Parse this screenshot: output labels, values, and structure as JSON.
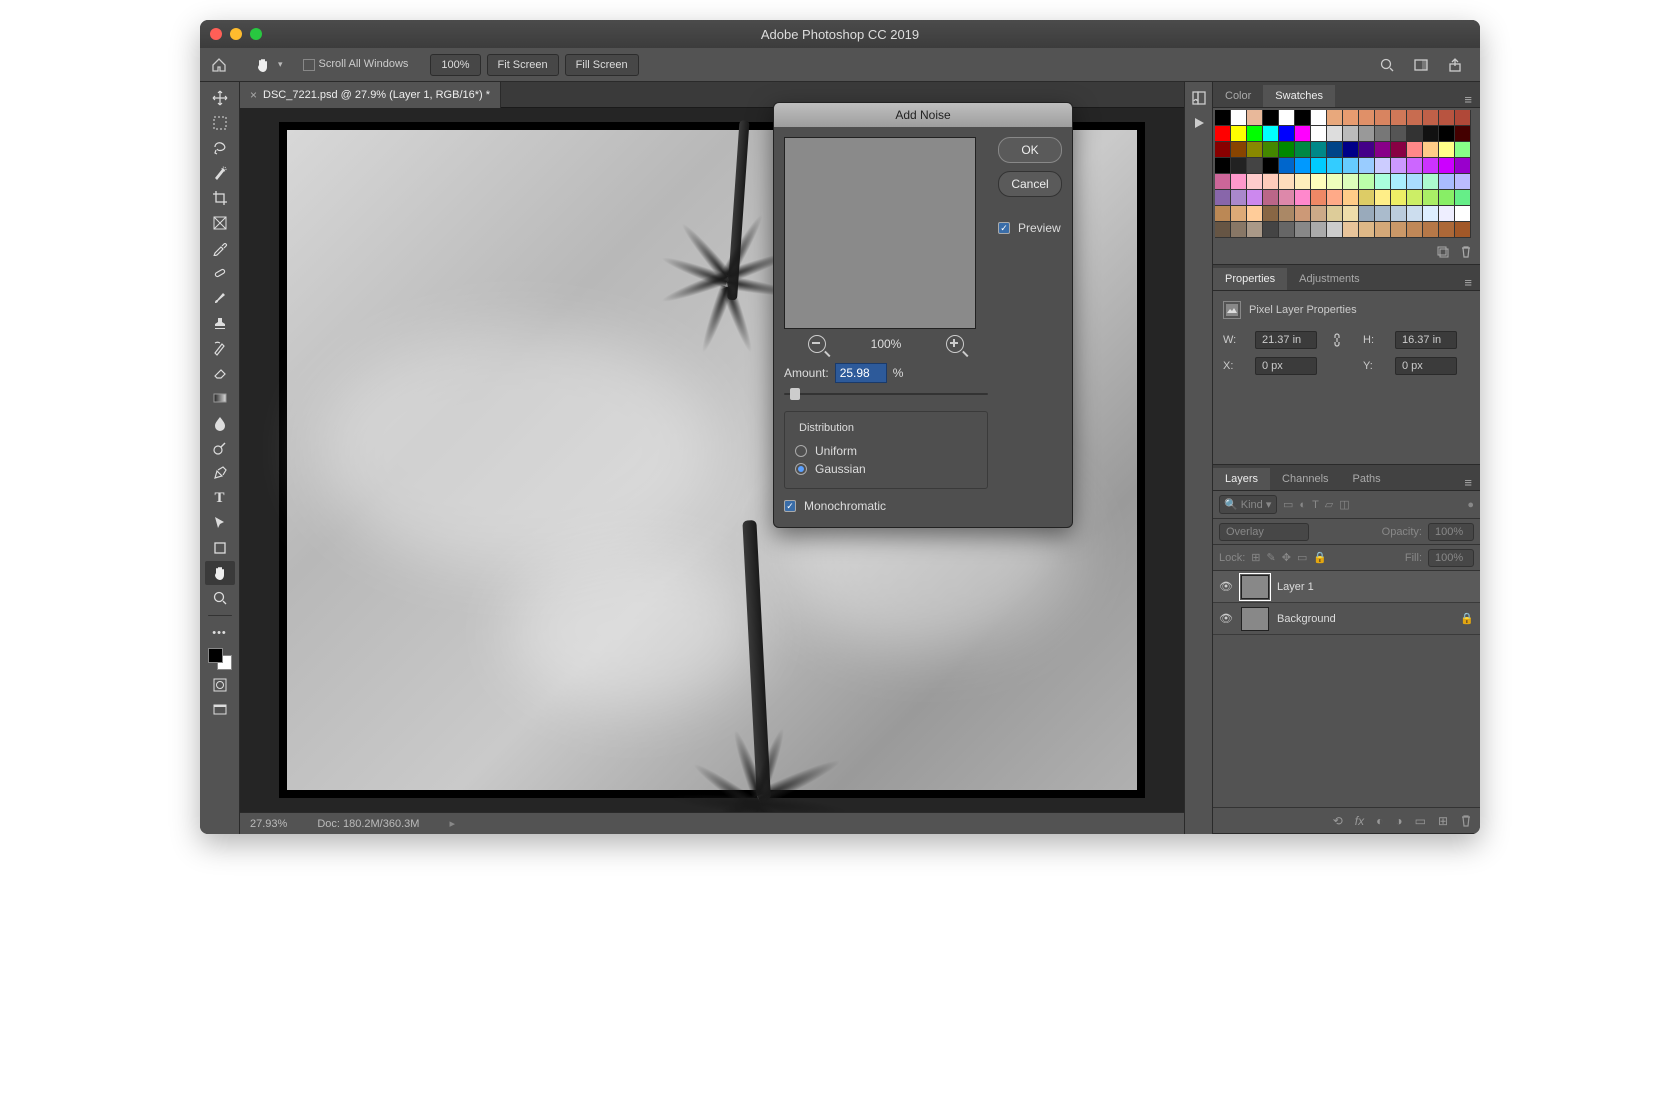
{
  "app": {
    "title": "Adobe Photoshop CC 2019"
  },
  "options_bar": {
    "scroll_all_label": "Scroll All Windows",
    "zoom_value": "100%",
    "fit_screen": "Fit Screen",
    "fill_screen": "Fill Screen"
  },
  "document": {
    "tab_label": "DSC_7221.psd @ 27.9% (Layer 1, RGB/16*) *",
    "status_zoom": "27.93%",
    "status_doc": "Doc: 180.2M/360.3M"
  },
  "dialog": {
    "title": "Add Noise",
    "ok": "OK",
    "cancel": "Cancel",
    "preview_label": "Preview",
    "preview_checked": true,
    "preview_zoom": "100%",
    "amount_label": "Amount:",
    "amount_value": "25.98",
    "amount_unit": "%",
    "distribution_label": "Distribution",
    "uniform": "Uniform",
    "gaussian": "Gaussian",
    "distribution_selected": "gaussian",
    "monochromatic": "Monochromatic",
    "monochromatic_checked": true
  },
  "panels": {
    "color_tab": "Color",
    "swatches_tab": "Swatches",
    "properties_tab": "Properties",
    "adjustments_tab": "Adjustments",
    "layers_tab": "Layers",
    "channels_tab": "Channels",
    "paths_tab": "Paths"
  },
  "properties": {
    "header": "Pixel Layer Properties",
    "w_label": "W:",
    "w_value": "21.37 in",
    "h_label": "H:",
    "h_value": "16.37 in",
    "x_label": "X:",
    "x_value": "0 px",
    "y_label": "Y:",
    "y_value": "0 px"
  },
  "layers": {
    "kind_placeholder": "Kind",
    "blend_mode": "Overlay",
    "opacity_label": "Opacity:",
    "opacity_value": "100%",
    "lock_label": "Lock:",
    "fill_label": "Fill:",
    "fill_value": "100%",
    "items": [
      {
        "name": "Layer 1",
        "selected": true,
        "locked": false
      },
      {
        "name": "Background",
        "selected": false,
        "locked": true
      }
    ]
  },
  "swatch_rows": [
    [
      "#000",
      "#fff",
      "#e8b89a",
      "#000",
      "#fff",
      "#000",
      "#fff",
      "#e8a87c",
      "#e89c70",
      "#e09068",
      "#d88460",
      "#d07858",
      "#c86c50",
      "#c06048",
      "#b85440",
      "#b04838"
    ],
    [
      "#f00",
      "#ff0",
      "#0f0",
      "#0ff",
      "#00f",
      "#f0f",
      "#fff",
      "#ddd",
      "#bbb",
      "#999",
      "#777",
      "#555",
      "#333",
      "#111",
      "#000",
      "#400"
    ],
    [
      "#800",
      "#840",
      "#880",
      "#480",
      "#080",
      "#084",
      "#088",
      "#048",
      "#008",
      "#408",
      "#808",
      "#804",
      "#f88",
      "#fc8",
      "#ff8",
      "#8f8"
    ],
    [
      "#000",
      "#222",
      "#444",
      "#000",
      "#06c",
      "#09f",
      "#0cf",
      "#3cf",
      "#6cf",
      "#9cf",
      "#ccf",
      "#c9f",
      "#c6f",
      "#c3f",
      "#c0f",
      "#90c"
    ],
    [
      "#c69",
      "#f9c",
      "#fcc",
      "#fcb",
      "#fdb",
      "#feb",
      "#ffb",
      "#efb",
      "#dfb",
      "#bfa",
      "#afd",
      "#aef",
      "#adf",
      "#acfacf",
      "#abf",
      "#bbf"
    ],
    [
      "#86a",
      "#a8c",
      "#c8e",
      "#b68",
      "#d8a",
      "#f8c",
      "#e86",
      "#fa8",
      "#fc8",
      "#dc6",
      "#fe8",
      "#ee6",
      "#ce6",
      "#ae6",
      "#8e6",
      "#6e8"
    ],
    [
      "#b85",
      "#da7",
      "#fc9",
      "#864",
      "#a86",
      "#c97",
      "#ca8",
      "#dc9",
      "#eda",
      "#9ab",
      "#abc",
      "#bcd",
      "#cde",
      "#def",
      "#eef",
      "#fff"
    ],
    [
      "#654",
      "#876",
      "#a98",
      "#444",
      "#666",
      "#888",
      "#aaa",
      "#ccc",
      "#e8c49a",
      "#deb887",
      "#d4a878",
      "#ca9868",
      "#c08858",
      "#b67848",
      "#ac6838",
      "#a25828"
    ]
  ]
}
